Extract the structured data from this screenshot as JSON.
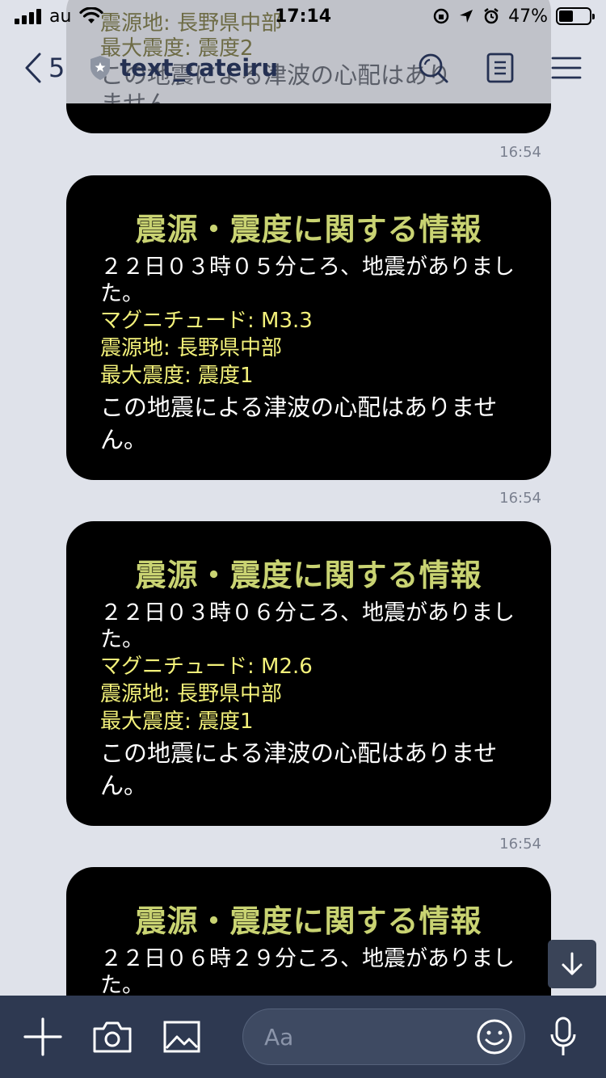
{
  "status_bar": {
    "carrier": "au",
    "time": "17:14",
    "battery": "47%",
    "battery_level": 0.47
  },
  "header": {
    "back_count": "5",
    "room_name": "text_cateiru"
  },
  "top_partial": {
    "region_line": "震源地: 長野県中部",
    "intensity_line": "最大震度: 震度2",
    "tsunami_line": "この地震による津波の心配はあり",
    "tsunami_line2": "ません。"
  },
  "messages": [
    {
      "time": "16:54",
      "title": "震源・震度に関する情報",
      "occurred": "２２日０３時０５分ころ、地震がありました。",
      "magnitude": "マグニチュード: M3.3",
      "epicenter": "震源地: 長野県中部",
      "max_intensity": "最大震度: 震度1",
      "tsunami": "この地震による津波の心配はありません。"
    },
    {
      "time": "16:54",
      "title": "震源・震度に関する情報",
      "occurred": "２２日０３時０６分ころ、地震がありました。",
      "magnitude": "マグニチュード: M2.6",
      "epicenter": "震源地: 長野県中部",
      "max_intensity": "最大震度: 震度1",
      "tsunami": "この地震による津波の心配はありません。"
    },
    {
      "time": "16:54",
      "title": "震源・震度に関する情報",
      "occurred": "２２日０６時２９分ころ、地震がありました。"
    }
  ],
  "input": {
    "placeholder": "Aa"
  }
}
